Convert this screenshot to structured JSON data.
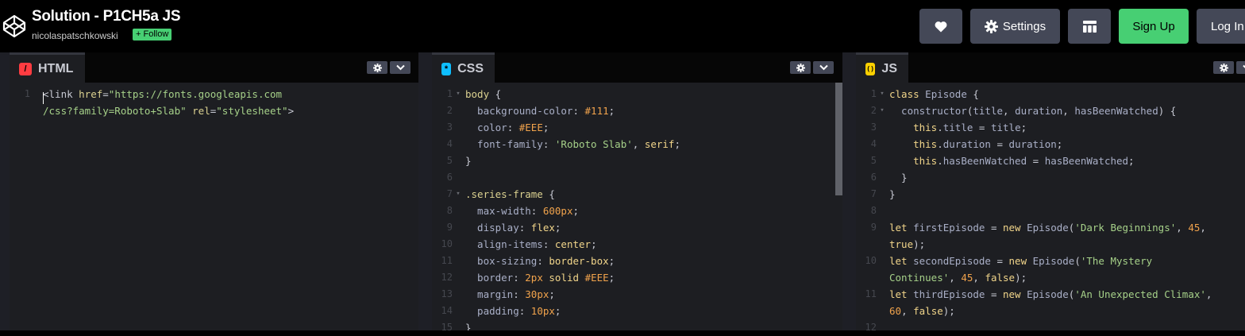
{
  "header": {
    "title": "Solution - P1CH5a JS",
    "author": "nicolaspatschkowski",
    "follow_label": "+ Follow",
    "settings_label": "Settings",
    "signup_label": "Sign Up",
    "login_label": "Log In",
    "icons": [
      "codepen-logo-icon",
      "heart-icon",
      "gear-icon",
      "layout-grid-icon"
    ]
  },
  "colors": {
    "accent_green": "#47cf73",
    "html_badge": "#ff3c41",
    "css_badge": "#0ebeff",
    "js_badge": "#fcd000",
    "editor_bg": "#1d1e22",
    "button_bg": "#444857"
  },
  "panes": [
    {
      "name": "HTML",
      "badge": "/",
      "lines": [
        {
          "num": "1",
          "fold": "",
          "segs": [
            [
              "<link ",
              "#c7c9d3"
            ],
            [
              "href",
              "#dcd291"
            ],
            [
              "=",
              "#c7c9d3"
            ],
            [
              "\"https://fonts.googleapis.com",
              "#a6d189"
            ]
          ]
        },
        {
          "num": "",
          "fold": "",
          "segs": [
            [
              "/css?family=Roboto+Slab\"",
              "#a6d189"
            ],
            [
              " ",
              "#c7c9d3"
            ],
            [
              "rel",
              "#dcd291"
            ],
            [
              "=",
              "#c7c9d3"
            ],
            [
              "\"stylesheet\"",
              "#a6d189"
            ],
            [
              ">",
              "#c7c9d3"
            ]
          ]
        }
      ]
    },
    {
      "name": "CSS",
      "badge": "*",
      "lines": [
        {
          "num": "1",
          "fold": "▾",
          "segs": [
            [
              "body",
              "#dcd291"
            ],
            [
              " {",
              "#c7c9d3"
            ]
          ]
        },
        {
          "num": "2",
          "fold": "",
          "segs": [
            [
              "  background-color",
              "#aab0c8"
            ],
            [
              ": ",
              "#c7c9d3"
            ],
            [
              "#111",
              "#f1a34c"
            ],
            [
              ";",
              "#c7c9d3"
            ]
          ]
        },
        {
          "num": "3",
          "fold": "",
          "segs": [
            [
              "  color",
              "#aab0c8"
            ],
            [
              ": ",
              "#c7c9d3"
            ],
            [
              "#EEE",
              "#f1a34c"
            ],
            [
              ";",
              "#c7c9d3"
            ]
          ]
        },
        {
          "num": "4",
          "fold": "",
          "segs": [
            [
              "  font-family",
              "#aab0c8"
            ],
            [
              ": ",
              "#c7c9d3"
            ],
            [
              "'Roboto Slab'",
              "#a6d189"
            ],
            [
              ", ",
              "#c7c9d3"
            ],
            [
              "serif",
              "#f1d58a"
            ],
            [
              ";",
              "#c7c9d3"
            ]
          ]
        },
        {
          "num": "5",
          "fold": "",
          "segs": [
            [
              "}",
              "#c7c9d3"
            ]
          ]
        },
        {
          "num": "6",
          "fold": "",
          "segs": [
            [
              "",
              "#c7c9d3"
            ]
          ]
        },
        {
          "num": "7",
          "fold": "▾",
          "segs": [
            [
              ".series-frame",
              "#dcd291"
            ],
            [
              " {",
              "#c7c9d3"
            ]
          ]
        },
        {
          "num": "8",
          "fold": "",
          "segs": [
            [
              "  max-width",
              "#aab0c8"
            ],
            [
              ": ",
              "#c7c9d3"
            ],
            [
              "600px",
              "#f1a34c"
            ],
            [
              ";",
              "#c7c9d3"
            ]
          ]
        },
        {
          "num": "9",
          "fold": "",
          "segs": [
            [
              "  display",
              "#aab0c8"
            ],
            [
              ": ",
              "#c7c9d3"
            ],
            [
              "flex",
              "#f1d58a"
            ],
            [
              ";",
              "#c7c9d3"
            ]
          ]
        },
        {
          "num": "10",
          "fold": "",
          "segs": [
            [
              "  align-items",
              "#aab0c8"
            ],
            [
              ": ",
              "#c7c9d3"
            ],
            [
              "center",
              "#f1d58a"
            ],
            [
              ";",
              "#c7c9d3"
            ]
          ]
        },
        {
          "num": "11",
          "fold": "",
          "segs": [
            [
              "  box-sizing",
              "#aab0c8"
            ],
            [
              ": ",
              "#c7c9d3"
            ],
            [
              "border-box",
              "#f1d58a"
            ],
            [
              ";",
              "#c7c9d3"
            ]
          ]
        },
        {
          "num": "12",
          "fold": "",
          "segs": [
            [
              "  border",
              "#aab0c8"
            ],
            [
              ": ",
              "#c7c9d3"
            ],
            [
              "2px",
              "#f1a34c"
            ],
            [
              " ",
              "#c7c9d3"
            ],
            [
              "solid",
              "#f1d58a"
            ],
            [
              " ",
              "#c7c9d3"
            ],
            [
              "#EEE",
              "#f1a34c"
            ],
            [
              ";",
              "#c7c9d3"
            ]
          ]
        },
        {
          "num": "13",
          "fold": "",
          "segs": [
            [
              "  margin",
              "#aab0c8"
            ],
            [
              ": ",
              "#c7c9d3"
            ],
            [
              "30px",
              "#f1a34c"
            ],
            [
              ";",
              "#c7c9d3"
            ]
          ]
        },
        {
          "num": "14",
          "fold": "",
          "segs": [
            [
              "  padding",
              "#aab0c8"
            ],
            [
              ": ",
              "#c7c9d3"
            ],
            [
              "10px",
              "#f1a34c"
            ],
            [
              ";",
              "#c7c9d3"
            ]
          ]
        },
        {
          "num": "15",
          "fold": "",
          "segs": [
            [
              "}",
              "#c7c9d3"
            ]
          ]
        }
      ]
    },
    {
      "name": "JS",
      "badge": "( )",
      "lines": [
        {
          "num": "1",
          "fold": "▾",
          "segs": [
            [
              "class",
              "#f1d58a"
            ],
            [
              " ",
              "#c7c9d3"
            ],
            [
              "Episode",
              "#aab0c8"
            ],
            [
              " {",
              "#c7c9d3"
            ]
          ]
        },
        {
          "num": "2",
          "fold": "▾",
          "segs": [
            [
              "  constructor",
              "#aab0c8"
            ],
            [
              "(",
              "#c7c9d3"
            ],
            [
              "title",
              "#aab0c8"
            ],
            [
              ", ",
              "#c7c9d3"
            ],
            [
              "duration",
              "#aab0c8"
            ],
            [
              ", ",
              "#c7c9d3"
            ],
            [
              "hasBeenWatched",
              "#aab0c8"
            ],
            [
              ") {",
              "#c7c9d3"
            ]
          ]
        },
        {
          "num": "3",
          "fold": "",
          "segs": [
            [
              "    this",
              "#f1d58a"
            ],
            [
              ".",
              "#c7c9d3"
            ],
            [
              "title",
              "#aab0c8"
            ],
            [
              " = ",
              "#c7c9d3"
            ],
            [
              "title",
              "#aab0c8"
            ],
            [
              ";",
              "#c7c9d3"
            ]
          ]
        },
        {
          "num": "4",
          "fold": "",
          "segs": [
            [
              "    this",
              "#f1d58a"
            ],
            [
              ".",
              "#c7c9d3"
            ],
            [
              "duration",
              "#aab0c8"
            ],
            [
              " = ",
              "#c7c9d3"
            ],
            [
              "duration",
              "#aab0c8"
            ],
            [
              ";",
              "#c7c9d3"
            ]
          ]
        },
        {
          "num": "5",
          "fold": "",
          "segs": [
            [
              "    this",
              "#f1d58a"
            ],
            [
              ".",
              "#c7c9d3"
            ],
            [
              "hasBeenWatched",
              "#aab0c8"
            ],
            [
              " = ",
              "#c7c9d3"
            ],
            [
              "hasBeenWatched",
              "#aab0c8"
            ],
            [
              ";",
              "#c7c9d3"
            ]
          ]
        },
        {
          "num": "6",
          "fold": "",
          "segs": [
            [
              "  }",
              "#c7c9d3"
            ]
          ]
        },
        {
          "num": "7",
          "fold": "",
          "segs": [
            [
              "}",
              "#c7c9d3"
            ]
          ]
        },
        {
          "num": "8",
          "fold": "",
          "segs": [
            [
              "",
              "#c7c9d3"
            ]
          ]
        },
        {
          "num": "9",
          "fold": "",
          "segs": [
            [
              "let",
              "#f1d58a"
            ],
            [
              " ",
              "#c7c9d3"
            ],
            [
              "firstEpisode",
              "#aab0c8"
            ],
            [
              " = ",
              "#c7c9d3"
            ],
            [
              "new",
              "#f1d58a"
            ],
            [
              " ",
              "#c7c9d3"
            ],
            [
              "Episode",
              "#aab0c8"
            ],
            [
              "(",
              "#c7c9d3"
            ],
            [
              "'Dark Beginnings'",
              "#a6d189"
            ],
            [
              ", ",
              "#c7c9d3"
            ],
            [
              "45",
              "#f1a34c"
            ],
            [
              ",",
              "#c7c9d3"
            ]
          ]
        },
        {
          "num": "",
          "fold": "",
          "segs": [
            [
              "true",
              "#f1d58a"
            ],
            [
              ");",
              "#c7c9d3"
            ]
          ]
        },
        {
          "num": "10",
          "fold": "",
          "segs": [
            [
              "let",
              "#f1d58a"
            ],
            [
              " ",
              "#c7c9d3"
            ],
            [
              "secondEpisode",
              "#aab0c8"
            ],
            [
              " = ",
              "#c7c9d3"
            ],
            [
              "new",
              "#f1d58a"
            ],
            [
              " ",
              "#c7c9d3"
            ],
            [
              "Episode",
              "#aab0c8"
            ],
            [
              "(",
              "#c7c9d3"
            ],
            [
              "'The Mystery",
              "#a6d189"
            ]
          ]
        },
        {
          "num": "",
          "fold": "",
          "segs": [
            [
              "Continues'",
              "#a6d189"
            ],
            [
              ", ",
              "#c7c9d3"
            ],
            [
              "45",
              "#f1a34c"
            ],
            [
              ", ",
              "#c7c9d3"
            ],
            [
              "false",
              "#f1d58a"
            ],
            [
              ");",
              "#c7c9d3"
            ]
          ]
        },
        {
          "num": "11",
          "fold": "",
          "segs": [
            [
              "let",
              "#f1d58a"
            ],
            [
              " ",
              "#c7c9d3"
            ],
            [
              "thirdEpisode",
              "#aab0c8"
            ],
            [
              " = ",
              "#c7c9d3"
            ],
            [
              "new",
              "#f1d58a"
            ],
            [
              " ",
              "#c7c9d3"
            ],
            [
              "Episode",
              "#aab0c8"
            ],
            [
              "(",
              "#c7c9d3"
            ],
            [
              "'An Unexpected Climax'",
              "#a6d189"
            ],
            [
              ",",
              "#c7c9d3"
            ]
          ]
        },
        {
          "num": "",
          "fold": "",
          "segs": [
            [
              "60",
              "#f1a34c"
            ],
            [
              ", ",
              "#c7c9d3"
            ],
            [
              "false",
              "#f1d58a"
            ],
            [
              ");",
              "#c7c9d3"
            ]
          ]
        },
        {
          "num": "12",
          "fold": "",
          "segs": [
            [
              "",
              "#c7c9d3"
            ]
          ]
        }
      ]
    }
  ]
}
